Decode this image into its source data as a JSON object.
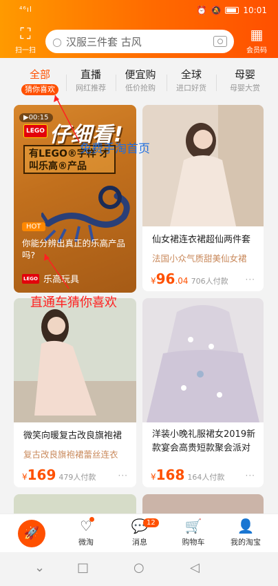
{
  "status_bar": {
    "signal": "⁴⁶ıl",
    "time": "10:01"
  },
  "header": {
    "scan_label": "扫一扫",
    "search_placeholder": "汉服三件套 古风",
    "member_label": "会员码"
  },
  "tabs": [
    {
      "title": "全部",
      "sub": "猜你喜欢"
    },
    {
      "title": "直播",
      "sub": "网红推荐"
    },
    {
      "title": "便宜购",
      "sub": "低价抢购"
    },
    {
      "title": "全球",
      "sub": "进口好货"
    },
    {
      "title": "母婴",
      "sub": "母婴大赏"
    }
  ],
  "lego_card": {
    "duration": "▶00:15",
    "logo": "LEGO",
    "headline": "仔细看!",
    "box_text": "有LEGO®字样 才叫乐高®产品",
    "hot": "HOT",
    "question": "你能分辨出真正的乐高产品吗?",
    "brand": "乐高玩具"
  },
  "products": [
    {
      "title": "仙女裙连衣裙超仙两件套",
      "sub": "法国小众气质甜美仙女裙",
      "price_int": "96",
      "price_dec": ".04",
      "sold": "706人付款"
    },
    {
      "title": "微笑向暖复古改良旗袍裙",
      "sub": "复古改良旗袍裙蕾丝连衣",
      "price_int": "169",
      "price_dec": "",
      "sold": "479人付款"
    },
    {
      "title": "洋装小晚礼服裙女2019新款宴会高贵短款聚会派对",
      "sub": "",
      "price_int": "168",
      "price_dec": "",
      "sold": "164人付款"
    }
  ],
  "annotations": {
    "home": "免费手淘首页",
    "guess": "直通车猜你喜欢"
  },
  "bottom_nav": [
    {
      "label": ""
    },
    {
      "label": "微淘"
    },
    {
      "label": "消息"
    },
    {
      "label": "购物车"
    },
    {
      "label": "我的淘宝"
    }
  ],
  "message_badge": "12",
  "currency": "¥",
  "more": "···",
  "colors": {
    "accent": "#ff5000",
    "annotation_blue": "#1f6fe0",
    "annotation_red": "#ff2020"
  }
}
